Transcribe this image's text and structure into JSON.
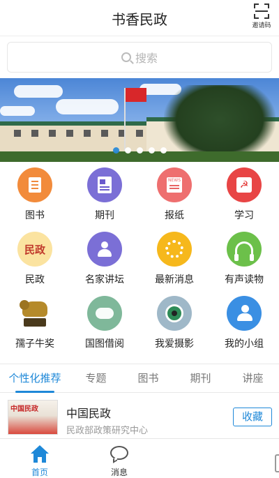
{
  "header": {
    "title": "书香民政",
    "invite_label": "邀请码"
  },
  "search": {
    "placeholder": "搜索"
  },
  "banner": {
    "slide_count": 5,
    "active_index": 0
  },
  "grid": {
    "items": [
      {
        "label": "图书",
        "icon": "book-icon",
        "color": "#f28b3b"
      },
      {
        "label": "期刊",
        "icon": "magazine-icon",
        "color": "#7b6fd6"
      },
      {
        "label": "报纸",
        "icon": "newspaper-icon",
        "color": "#ee6f6f"
      },
      {
        "label": "学习",
        "icon": "party-emblem-icon",
        "color": "#e84545"
      },
      {
        "label": "民政",
        "icon": "minzheng-logo-icon",
        "color": "#fbe3a0",
        "icon_text": "民政"
      },
      {
        "label": "名家讲坛",
        "icon": "lecturer-icon",
        "color": "#7b6fd6"
      },
      {
        "label": "最新消息",
        "icon": "loading-spinner-icon",
        "color": "#f6b81c"
      },
      {
        "label": "有声读物",
        "icon": "headphones-icon",
        "color": "#6cc04a"
      },
      {
        "label": "孺子牛奖",
        "icon": "bull-trophy-icon",
        "color": "#ffffff"
      },
      {
        "label": "国图借阅",
        "icon": "handshake-icon",
        "color": "#7fb89a"
      },
      {
        "label": "我爱摄影",
        "icon": "camera-photography-icon",
        "color": "#9fb8c8"
      },
      {
        "label": "我的小组",
        "icon": "group-icon",
        "color": "#3a8fe3"
      }
    ]
  },
  "tabs": [
    {
      "label": "个性化推荐",
      "active": true
    },
    {
      "label": "专题",
      "active": false
    },
    {
      "label": "图书",
      "active": false
    },
    {
      "label": "期刊",
      "active": false
    },
    {
      "label": "讲座",
      "active": false
    }
  ],
  "recommend": {
    "cover_title": "中国民政",
    "name": "中国民政",
    "org": "民政部政策研究中心",
    "favorite_label": "收藏"
  },
  "tabbar": {
    "items": [
      {
        "label": "首页",
        "icon": "home-icon",
        "active": true
      },
      {
        "label": "消息",
        "icon": "message-icon",
        "active": false
      }
    ]
  },
  "colors": {
    "accent": "#1e88d8"
  }
}
